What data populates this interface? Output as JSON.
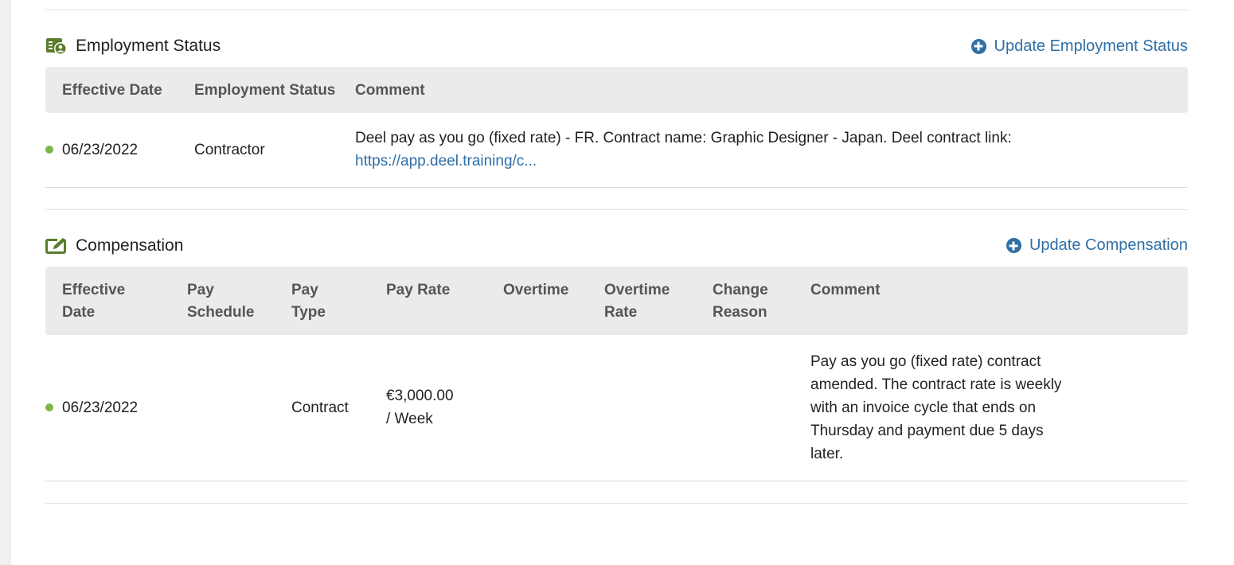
{
  "employment_status": {
    "title": "Employment Status",
    "action_label": "Update Employment Status",
    "headers": {
      "effective_date": "Effective Date",
      "employment_status": "Employment Status",
      "comment": "Comment"
    },
    "rows": [
      {
        "effective_date": "06/23/2022",
        "employment_status": "Contractor",
        "comment": "Deel pay as you go (fixed rate) - FR. Contract name: Graphic Designer - Japan. Deel contract link:",
        "comment_link": "https://app.deel.training/c..."
      }
    ]
  },
  "compensation": {
    "title": "Compensation",
    "action_label": "Update Compensation",
    "headers": {
      "effective_date": "Effective Date",
      "pay_schedule": "Pay Schedule",
      "pay_type": "Pay Type",
      "pay_rate": "Pay Rate",
      "overtime": "Overtime",
      "overtime_rate": "Overtime Rate",
      "change_reason": "Change Reason",
      "comment": "Comment"
    },
    "rows": [
      {
        "effective_date": "06/23/2022",
        "pay_schedule": "",
        "pay_type": "Contract",
        "pay_rate_amount": "€3,000.00",
        "pay_rate_period": "/ Week",
        "overtime": "",
        "overtime_rate": "",
        "change_reason": "",
        "comment": "Pay as you go (fixed rate) contract amended. The contract rate is weekly with an invoice cycle that ends on Thursday and payment due 5 days later."
      }
    ]
  },
  "colors": {
    "accent": "#2f6fa6",
    "icon_green": "#5a7d2a",
    "status_dot": "#7ab648",
    "header_bg": "#ebebeb"
  },
  "icons": {
    "employment_status": "id-badge-icon",
    "compensation": "edit-note-icon",
    "add": "plus-circle-icon"
  }
}
